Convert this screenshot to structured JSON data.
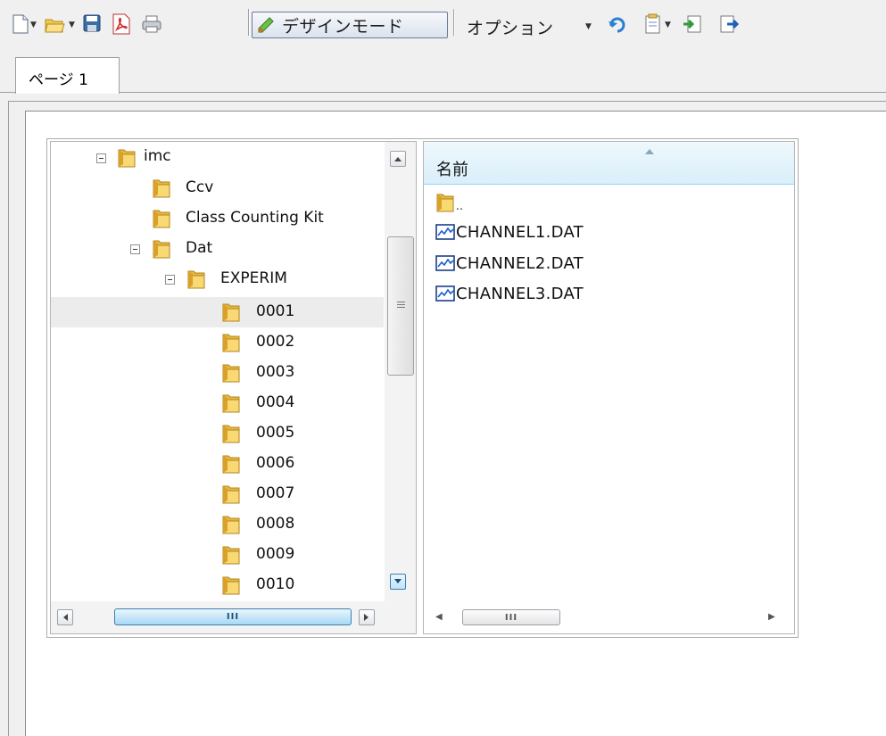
{
  "toolbar": {
    "design_mode_label": "デザインモード",
    "options_label": "オプション"
  },
  "tabs": [
    {
      "label": "ページ 1"
    }
  ],
  "tree": {
    "items": [
      {
        "label": "imc"
      },
      {
        "label": "Ccv"
      },
      {
        "label": "Class Counting Kit"
      },
      {
        "label": "Dat"
      },
      {
        "label": "EXPERIM"
      },
      {
        "label": "0001"
      },
      {
        "label": "0002"
      },
      {
        "label": "0003"
      },
      {
        "label": "0004"
      },
      {
        "label": "0005"
      },
      {
        "label": "0006"
      },
      {
        "label": "0007"
      },
      {
        "label": "0008"
      },
      {
        "label": "0009"
      },
      {
        "label": "0010"
      }
    ],
    "selected": "0001"
  },
  "list": {
    "column_header": "名前",
    "items": [
      {
        "label": "..",
        "icon": "folder-icon"
      },
      {
        "label": "CHANNEL1.DAT",
        "icon": "waveform-file-icon"
      },
      {
        "label": "CHANNEL2.DAT",
        "icon": "waveform-file-icon"
      },
      {
        "label": "CHANNEL3.DAT",
        "icon": "waveform-file-icon"
      }
    ]
  },
  "scroll_grip": "III"
}
